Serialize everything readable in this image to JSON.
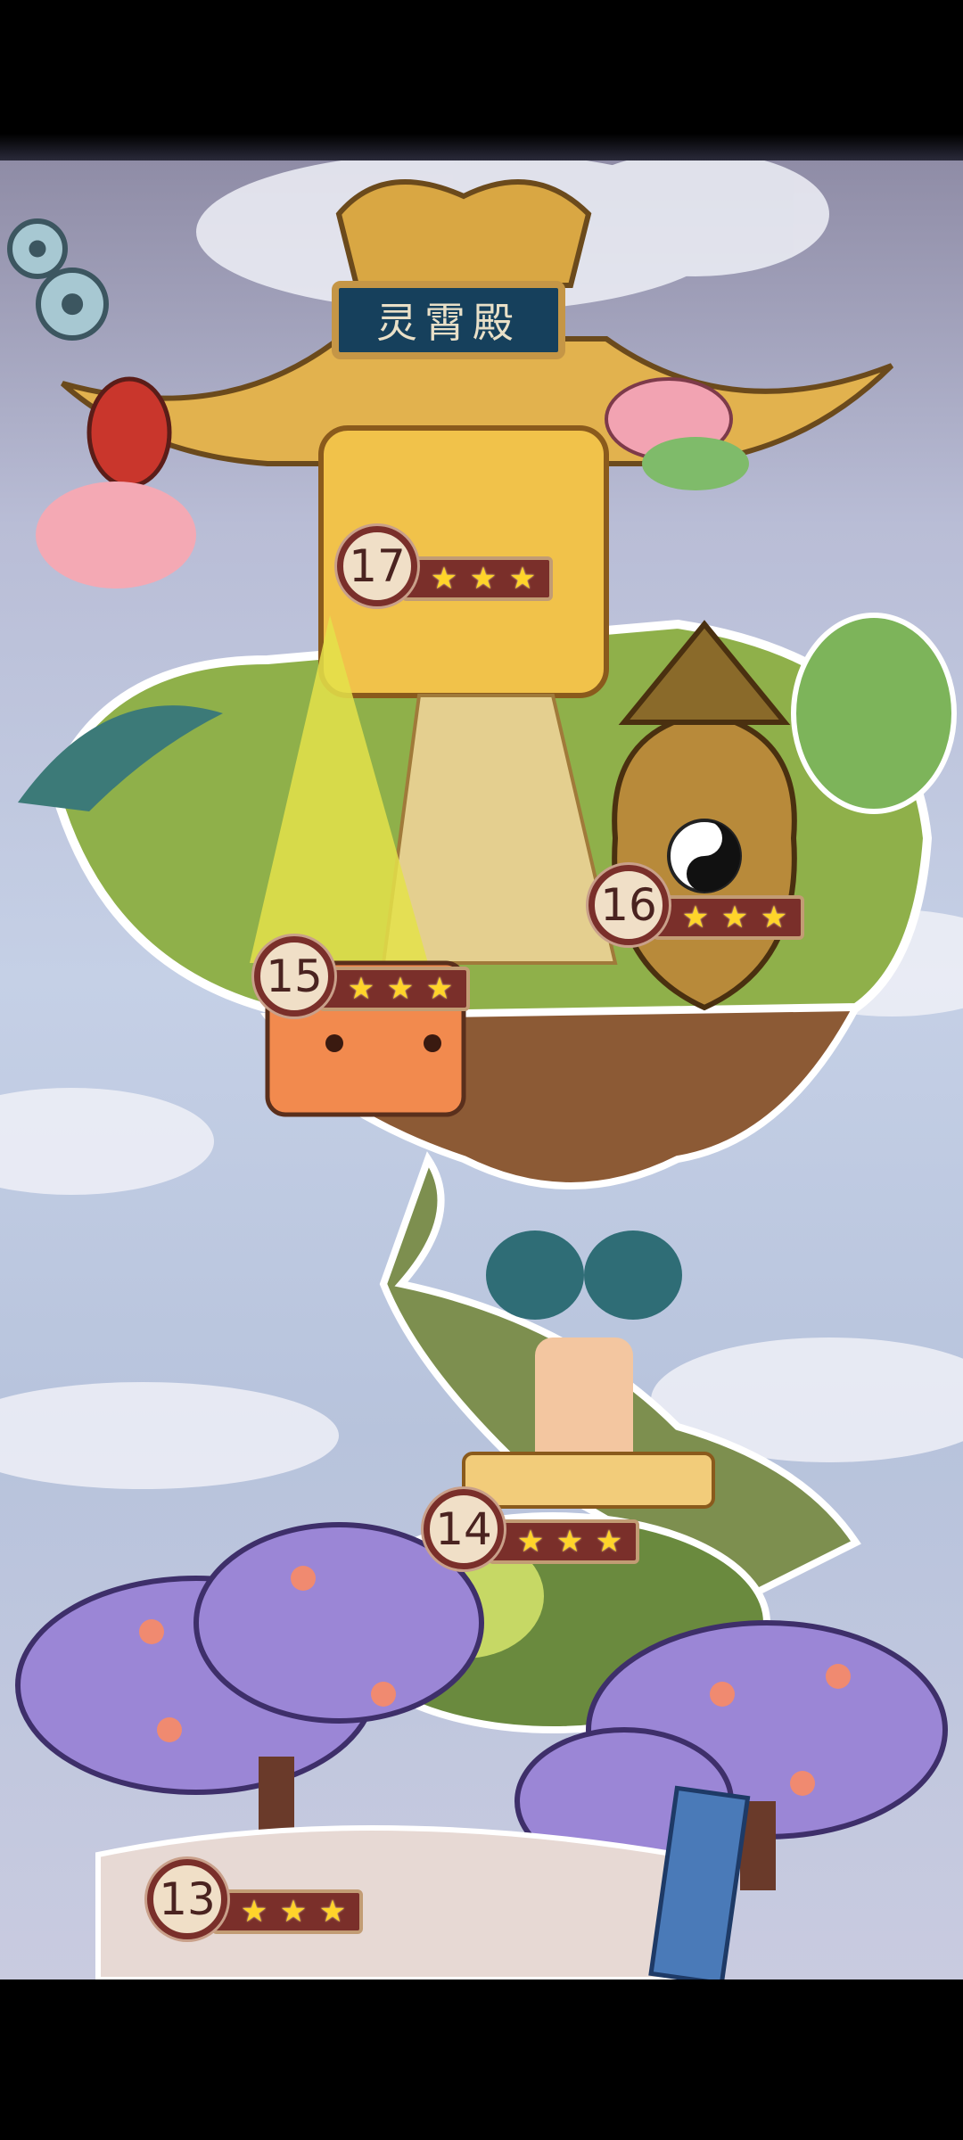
{
  "hall_sign": "灵霄殿",
  "levels": [
    {
      "number": "17",
      "stars": [
        "★",
        "★",
        "★"
      ],
      "star_count": 3
    },
    {
      "number": "16",
      "stars": [
        "★",
        "★",
        "★"
      ],
      "star_count": 3
    },
    {
      "number": "15",
      "stars": [
        "★",
        "★",
        "★"
      ],
      "star_count": 3
    },
    {
      "number": "14",
      "stars": [
        "★",
        "★",
        "★"
      ],
      "star_count": 3
    },
    {
      "number": "13",
      "stars": [
        "★",
        "★",
        "★"
      ],
      "star_count": 3
    }
  ],
  "icons": {
    "settings": "gear-icon",
    "star": "star-icon"
  },
  "colors": {
    "badge_border": "#7a2f2a",
    "star": "#ffd42a",
    "sign_bg": "#16405c"
  }
}
